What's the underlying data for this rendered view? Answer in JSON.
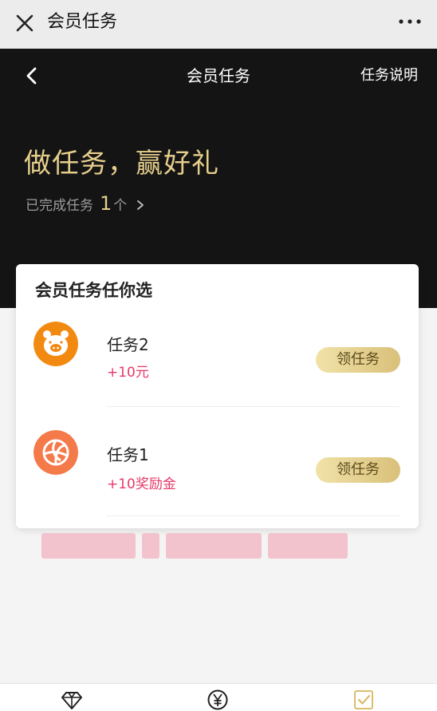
{
  "topbar": {
    "title": "会员任务",
    "close_icon": "close-icon",
    "more_icon": "more-icon"
  },
  "header": {
    "back_icon": "chevron-left-icon",
    "title": "会员任务",
    "help": "任务说明"
  },
  "hero": {
    "headline": "做任务，赢好礼",
    "done_prefix": "已完成任务",
    "done_count": "1",
    "done_suffix": "个"
  },
  "card": {
    "title": "会员任务任你选",
    "tasks": [
      {
        "icon": "pig-icon",
        "icon_color": "#f28a12",
        "name": "任务2",
        "reward": "+10元",
        "button": "领任务"
      },
      {
        "icon": "volleyball-icon",
        "icon_color": "#f47a4a",
        "name": "任务1",
        "reward": "+10奖励金",
        "button": "领任务"
      }
    ]
  },
  "tabbar": {
    "items": [
      {
        "icon": "diamond-icon"
      },
      {
        "icon": "yen-icon"
      },
      {
        "icon": "checkbox-icon"
      }
    ]
  },
  "colors": {
    "hero_bg": "#141414",
    "gold": "#e6cf8c",
    "reward": "#e8386a"
  }
}
